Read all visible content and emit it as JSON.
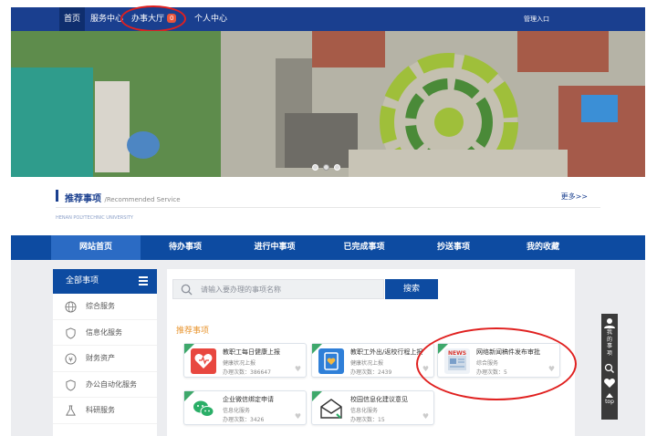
{
  "top": {
    "nav": [
      {
        "label": "首页"
      },
      {
        "label": "服务中心"
      },
      {
        "label": "办事大厅",
        "badge": "0"
      },
      {
        "label": "个人中心"
      }
    ],
    "admin": "管理入口"
  },
  "recommend_bar": {
    "title": "推荐事项",
    "subtitle": "/Recommended Service",
    "more": "更多>>"
  },
  "logo_text": "HENAN POLYTECHNIC UNIVERSITY",
  "main_nav": [
    {
      "label": "网站首页"
    },
    {
      "label": "待办事项"
    },
    {
      "label": "进行中事项"
    },
    {
      "label": "已完成事项"
    },
    {
      "label": "抄送事项"
    },
    {
      "label": "我的收藏"
    }
  ],
  "sidebar": {
    "title": "全部事项",
    "items": [
      {
        "label": "综合服务",
        "icon": "globe-icon"
      },
      {
        "label": "信息化服务",
        "icon": "shield-icon"
      },
      {
        "label": "财务资产",
        "icon": "money-icon"
      },
      {
        "label": "办公自动化服务",
        "icon": "shield-icon"
      },
      {
        "label": "科研服务",
        "icon": "flask-icon"
      }
    ]
  },
  "search": {
    "placeholder": "请输入要办理的事项名称",
    "button": "搜索"
  },
  "recommended": {
    "title": "推荐事项",
    "cards": [
      {
        "name": "教职工每日健康上报",
        "category": "健康状况上报",
        "count": "办理次数：386647",
        "icon": "health-heart-icon"
      },
      {
        "name": "教职工外出/返校行程上报",
        "category": "健康状况上报",
        "count": "办理次数：2439",
        "icon": "report-clipboard-icon"
      },
      {
        "name": "网络新闻稿件发布审批",
        "category": "综合服务",
        "count": "办理次数：5",
        "icon": "news-icon"
      },
      {
        "name": "企业微信绑定申请",
        "category": "信息化服务",
        "count": "办理次数：3426",
        "icon": "wechat-icon"
      },
      {
        "name": "校园信息化建议意见",
        "category": "信息化服务",
        "count": "办理次数：15",
        "icon": "envelope-icon"
      }
    ]
  },
  "right_toolbar": {
    "my_items": "我的事项",
    "top": "top"
  },
  "colors": {
    "nav_blue": "#1a3f8f",
    "main_blue": "#0d4ba1",
    "highlight_red": "#e0201f",
    "ribbon_green": "#3ea86b",
    "accent_orange": "#e8952f"
  }
}
